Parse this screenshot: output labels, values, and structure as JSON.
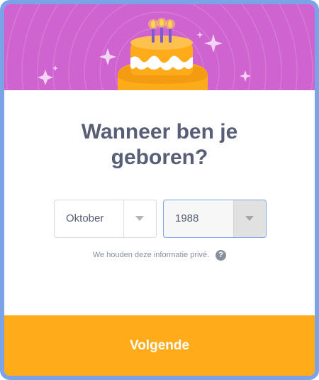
{
  "header": {
    "illustration": "birthday-cake-icon",
    "background_color": "#cf63cf"
  },
  "title": {
    "line1": "Wanneer ben je",
    "line2": "geboren?"
  },
  "birthdate": {
    "month": {
      "value": "Oktober",
      "arrow_icon": "chevron-down-icon"
    },
    "year": {
      "value": "1988",
      "arrow_icon": "chevron-down-icon"
    }
  },
  "privacy": {
    "text": "We houden deze informatie privé.",
    "help_icon_glyph": "?"
  },
  "next_button": {
    "label": "Volgende",
    "color": "#ffab1a"
  },
  "colors": {
    "accent": "#ffab1a",
    "text": "#575e75",
    "frame": "#7aa3e8"
  }
}
